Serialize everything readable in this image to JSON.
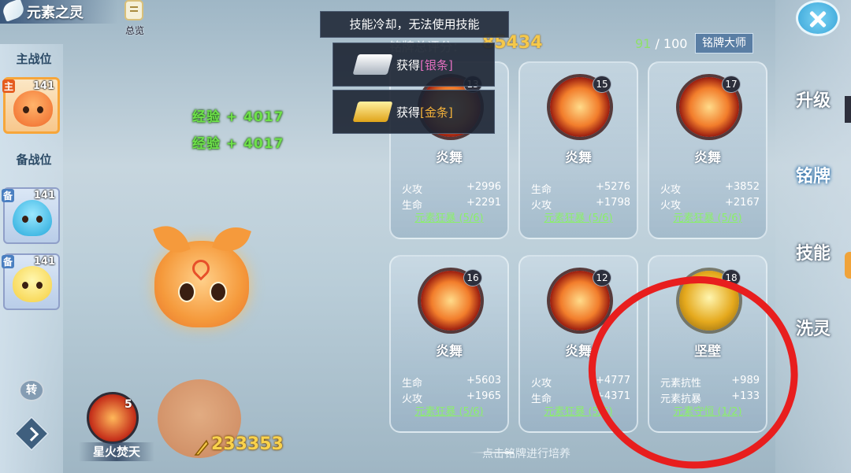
{
  "header": {
    "title": "元素之灵",
    "overview_label": "总览"
  },
  "sidebar": {
    "main_label": "主战位",
    "backup_label": "备战位",
    "switch_label": "转",
    "slots": [
      {
        "level": "141",
        "tag": "主",
        "element": "fire"
      },
      {
        "level": "141",
        "tag": "备",
        "element": "water"
      },
      {
        "level": "141",
        "tag": "备",
        "element": "light"
      }
    ]
  },
  "exp_gains": [
    "经验 + 4017",
    "经验 + 4017"
  ],
  "skill": {
    "level": "5",
    "name": "星火焚天"
  },
  "currency": {
    "value": "233353"
  },
  "toast": {
    "cooldown": "技能冷却，无法使用技能"
  },
  "gains": [
    {
      "prefix": "获得",
      "item": "[银条]"
    },
    {
      "prefix": "获得",
      "item": "[金条]"
    }
  ],
  "score": {
    "label": "铭牌总评分：",
    "value": "85434"
  },
  "progress": {
    "current": "91",
    "total": "/ 100"
  },
  "master_button": "铭牌大师",
  "cards": [
    {
      "level": "13",
      "name": "炎舞",
      "stats": [
        {
          "k": "火攻",
          "v": "+2996"
        },
        {
          "k": "生命",
          "v": "+2291"
        }
      ],
      "set": "元素狂暴 (5/6)"
    },
    {
      "level": "15",
      "name": "炎舞",
      "stats": [
        {
          "k": "生命",
          "v": "+5276"
        },
        {
          "k": "火攻",
          "v": "+1798"
        }
      ],
      "set": "元素狂暴 (5/6)"
    },
    {
      "level": "17",
      "name": "炎舞",
      "stats": [
        {
          "k": "火攻",
          "v": "+3852"
        },
        {
          "k": "火攻",
          "v": "+2167"
        }
      ],
      "set": "元素狂暴 (5/6)"
    },
    {
      "level": "16",
      "name": "炎舞",
      "stats": [
        {
          "k": "生命",
          "v": "+5603"
        },
        {
          "k": "火攻",
          "v": "+1965"
        }
      ],
      "set": "元素狂暴 (5/6)"
    },
    {
      "level": "12",
      "name": "炎舞",
      "stats": [
        {
          "k": "火攻",
          "v": "+4777"
        },
        {
          "k": "生命",
          "v": "+4371"
        }
      ],
      "set": "元素狂暴 (5/6)"
    },
    {
      "level": "18",
      "name": "坚壁",
      "stats": [
        {
          "k": "元素抗性",
          "v": "+989"
        },
        {
          "k": "元素抗暴",
          "v": "+133"
        }
      ],
      "set": "元素守恒 (1/2)"
    }
  ],
  "nav": {
    "upgrade": "升级",
    "plate": "铭牌",
    "skill": "技能",
    "wash": "洗灵"
  },
  "footer_hint": "点击铭牌进行培养",
  "annotation_color": "#e81e1e"
}
